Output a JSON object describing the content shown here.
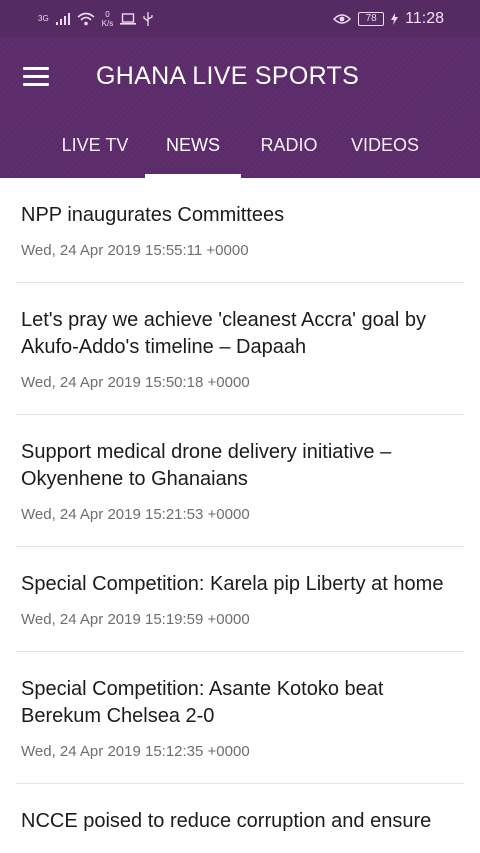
{
  "status_bar": {
    "network_type": "3G",
    "net_speed_value": "0",
    "net_speed_unit": "K/s",
    "battery": "78",
    "time": "11:28",
    "icons": [
      "signal-icon",
      "wifi-icon",
      "laptop-icon",
      "usb-icon",
      "eye-icon",
      "battery-icon",
      "charging-icon"
    ]
  },
  "app": {
    "title": "GHANA LIVE SPORTS",
    "accent_color": "#5c2c6b"
  },
  "tabs": [
    {
      "label": "LIVE TV",
      "selected": false
    },
    {
      "label": "NEWS",
      "selected": true
    },
    {
      "label": "RADIO",
      "selected": false
    },
    {
      "label": "VIDEOS",
      "selected": false
    }
  ],
  "news": [
    {
      "title": "NPP inaugurates Committees",
      "date": "Wed, 24 Apr 2019 15:55:11 +0000"
    },
    {
      "title": "Let's pray we achieve 'cleanest Accra' goal by Akufo-Addo's timeline – Dapaah",
      "date": "Wed, 24 Apr 2019 15:50:18 +0000"
    },
    {
      "title": "Support medical drone delivery initiative – Okyenhene to Ghanaians",
      "date": "Wed, 24 Apr 2019 15:21:53 +0000"
    },
    {
      "title": "Special Competition: Karela pip Liberty at home",
      "date": "Wed, 24 Apr 2019 15:19:59 +0000"
    },
    {
      "title": "Special Competition: Asante Kotoko beat Berekum Chelsea 2-0",
      "date": "Wed, 24 Apr 2019 15:12:35 +0000"
    },
    {
      "title": "NCCE poised to reduce corruption and ensure",
      "date": ""
    }
  ]
}
